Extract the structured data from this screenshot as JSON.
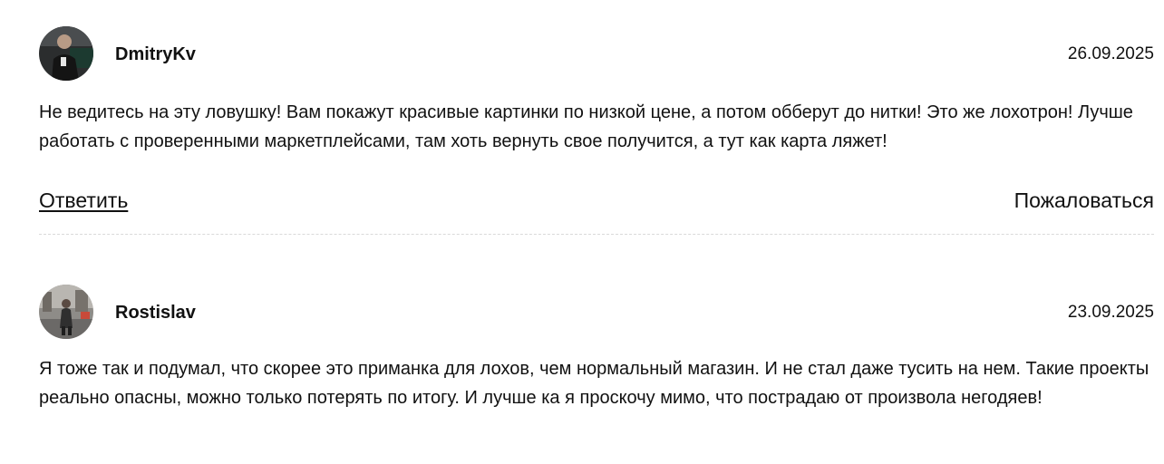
{
  "comments": [
    {
      "author": "DmitryKv",
      "date": "26.09.2025",
      "avatar_icon": "user-photo-avatar",
      "text": "Не ведитесь на эту ловушку! Вам покажут красивые картинки по низкой цене, а потом обберут до нитки! Это же лохотрон! Лучше работать с проверенными маркетплейсами, там хоть вернуть свое получится, а тут как карта ляжет!",
      "reply_label": "Ответить",
      "report_label": "Пожаловаться"
    },
    {
      "author": "Rostislav",
      "date": "23.09.2025",
      "avatar_icon": "user-photo-avatar",
      "text": "Я тоже так и подумал, что скорее это приманка для лохов, чем нормальный магазин. И не стал даже тусить на нем. Такие проекты реально опасны, можно только потерять по итогу. И лучше ка я проскочу мимо, что пострадаю от произвола негодяев!"
    }
  ],
  "colors": {
    "text": "#111111",
    "divider": "#d9d9d9",
    "background": "#ffffff"
  }
}
